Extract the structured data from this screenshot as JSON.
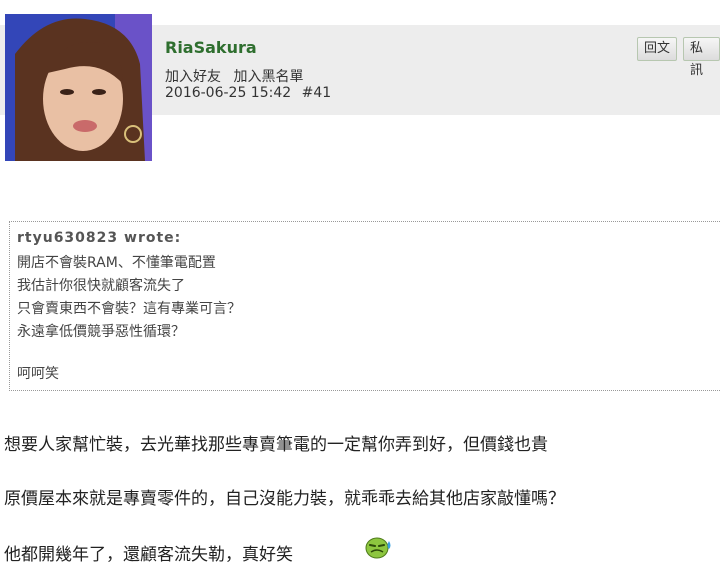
{
  "post": {
    "username": "RiaSakura",
    "actions": [
      "加入好友",
      "加入黑名單"
    ],
    "date": "2016-06-25 15:42",
    "post_number": "#41",
    "buttons": {
      "reply": "回文",
      "pm": "私訊"
    }
  },
  "quote": {
    "author": "rtyu630823 wrote:",
    "lines": [
      "開店不會裝RAM、不懂筆電配置",
      "我估計你很快就顧客流失了",
      "只會賣東西不會裝？這有專業可言？",
      "永遠拿低價競爭惡性循環？",
      "",
      "呵呵笑"
    ]
  },
  "body": {
    "lines": [
      "想要人家幫忙裝，去光華找那些專賣筆電的一定幫你弄到好，但價錢也貴",
      "原價屋本來就是專賣零件的，自己沒能力裝，就乖乖去給其他店家敲懂嗎？",
      "他都開幾年了，還顧客流失勒，真好笑"
    ]
  },
  "icons": {
    "smiley": "sweat-smiley-icon"
  }
}
